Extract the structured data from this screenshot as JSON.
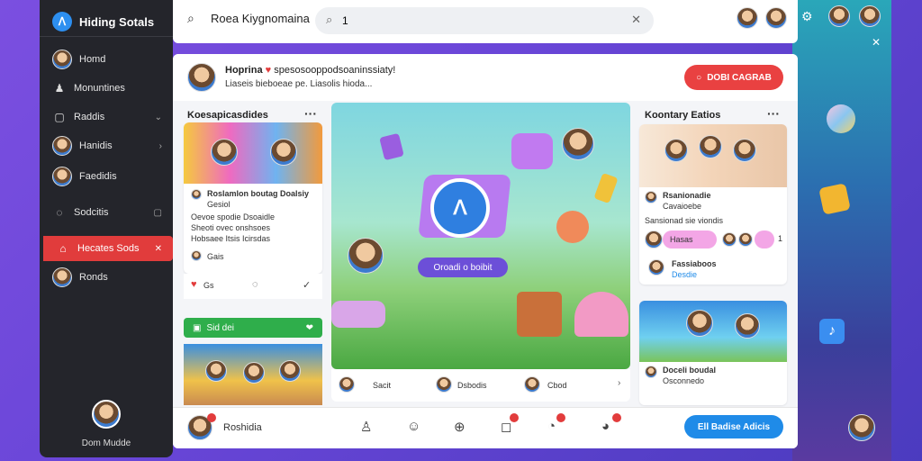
{
  "sidebar": {
    "brand": "Hiding Sotals",
    "items": [
      {
        "label": "Homd",
        "icon": "avatar"
      },
      {
        "label": "Monuntines",
        "icon": "people-icon"
      },
      {
        "label": "Raddis",
        "icon": "box-icon"
      },
      {
        "label": "Hanidis",
        "icon": "avatar"
      },
      {
        "label": "Faedidis",
        "icon": "avatar"
      },
      {
        "label": "Sodcitis",
        "icon": "chat-icon"
      },
      {
        "label": "Hecates Sods",
        "icon": "home-icon"
      },
      {
        "label": "Ronds",
        "icon": "avatar"
      }
    ],
    "profile_name": "Dom Mudde"
  },
  "topbar": {
    "title": "Roea Kiygnomaina",
    "search_value": "1",
    "search_placeholder": ""
  },
  "post": {
    "author": "Hoprina",
    "line1": "spesosooppodsoaninssiaty!",
    "line2": "Liaseis bieboeae pe. Liasolis hioda...",
    "cta_label": "DOBI CAGRAB"
  },
  "left_column": {
    "title": "Koesapicasdides",
    "card1": {
      "name": "Roslamlon boutag Doalsiy",
      "sub": "Gesiol",
      "body1": "Oevoe spodie Dsoaidle",
      "body2": "Sheoti ovec onshsoes",
      "body3": "Hobsaee Itsis Icirsdas",
      "reaction": "Gais",
      "likes": "Gs"
    },
    "green_bar": "Sid dei"
  },
  "hero": {
    "button_label": "Oroadi o boibit"
  },
  "hero_footer": {
    "item1": "Sacit",
    "item2": "Dsbodis",
    "item3": "Cbod"
  },
  "right_column": {
    "title": "Koontary Eatios",
    "card1": {
      "name": "Rsanionadie",
      "sub": "Cavaioebe",
      "body": "Sansionad sie viondis",
      "pill": "Hasas",
      "count": "1",
      "footer_name": "Fassiaboos",
      "footer_sub": "Desdie"
    },
    "card2": {
      "name": "Doceli boudal",
      "sub": "Osconnedo"
    }
  },
  "bottombar": {
    "name": "Roshidia",
    "action_label": "Ell Badise Adicis"
  },
  "colors": {
    "accent_red": "#e94141",
    "accent_blue": "#1f8be8",
    "accent_purple": "#6c4fd8",
    "sidebar_bg": "#24252b"
  }
}
